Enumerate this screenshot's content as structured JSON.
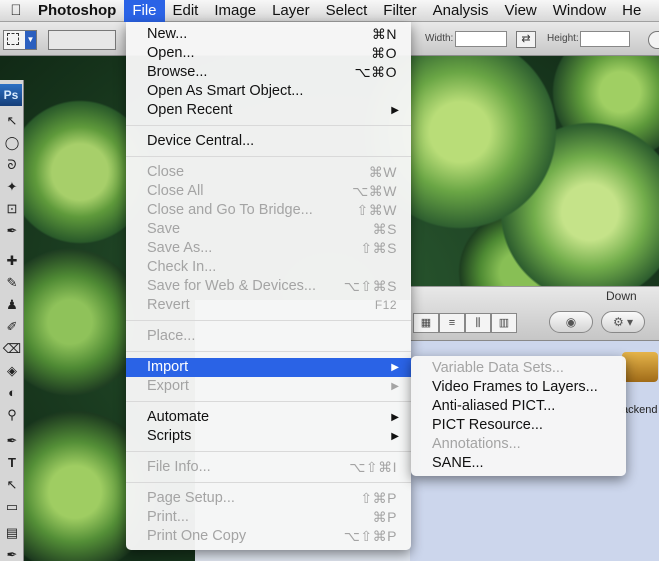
{
  "menubar": {
    "apple_icon": "",
    "app_name": "Photoshop",
    "menus": [
      "File",
      "Edit",
      "Image",
      "Layer",
      "Select",
      "Filter",
      "Analysis",
      "View",
      "Window",
      "He"
    ],
    "active_menu": "File"
  },
  "options_bar": {
    "width_label": "Width:",
    "height_label": "Height:"
  },
  "tool_panel": {
    "badge": "Ps"
  },
  "finder": {
    "location_label": "Down",
    "package_label": "ackend"
  },
  "file_menu": {
    "items": [
      {
        "label": "New...",
        "shortcut": "⌘N"
      },
      {
        "label": "Open...",
        "shortcut": "⌘O"
      },
      {
        "label": "Browse...",
        "shortcut": "⌥⌘O"
      },
      {
        "label": "Open As Smart Object..."
      },
      {
        "label": "Open Recent"
      },
      {
        "label": "Device Central..."
      },
      {
        "label": "Close",
        "shortcut": "⌘W"
      },
      {
        "label": "Close All",
        "shortcut": "⌥⌘W"
      },
      {
        "label": "Close and Go To Bridge...",
        "shortcut": "⇧⌘W"
      },
      {
        "label": "Save",
        "shortcut": "⌘S"
      },
      {
        "label": "Save As...",
        "shortcut": "⇧⌘S"
      },
      {
        "label": "Check In..."
      },
      {
        "label": "Save for Web & Devices...",
        "shortcut": "⌥⇧⌘S"
      },
      {
        "label": "Revert",
        "shortcut": "F12"
      },
      {
        "label": "Place..."
      },
      {
        "label": "Import"
      },
      {
        "label": "Export"
      },
      {
        "label": "Automate"
      },
      {
        "label": "Scripts"
      },
      {
        "label": "File Info...",
        "shortcut": "⌥⇧⌘I"
      },
      {
        "label": "Page Setup...",
        "shortcut": "⇧⌘P"
      },
      {
        "label": "Print...",
        "shortcut": "⌘P"
      },
      {
        "label": "Print One Copy",
        "shortcut": "⌥⇧⌘P"
      }
    ]
  },
  "import_menu": {
    "items": [
      {
        "label": "Variable Data Sets..."
      },
      {
        "label": "Video Frames to Layers..."
      },
      {
        "label": "Anti-aliased PICT..."
      },
      {
        "label": "PICT Resource..."
      },
      {
        "label": "Annotations..."
      },
      {
        "label": "SANE..."
      }
    ]
  },
  "icons": {
    "submenu_arrow": "▶",
    "tool_icons": [
      "↖",
      "◯",
      "⌇",
      "✎",
      "⊡",
      "✒",
      "⌫",
      "✐",
      "⚲",
      "◐",
      "✦",
      "⬚",
      "⌖",
      "✏",
      "T",
      "↖",
      "▭",
      "✋"
    ]
  }
}
